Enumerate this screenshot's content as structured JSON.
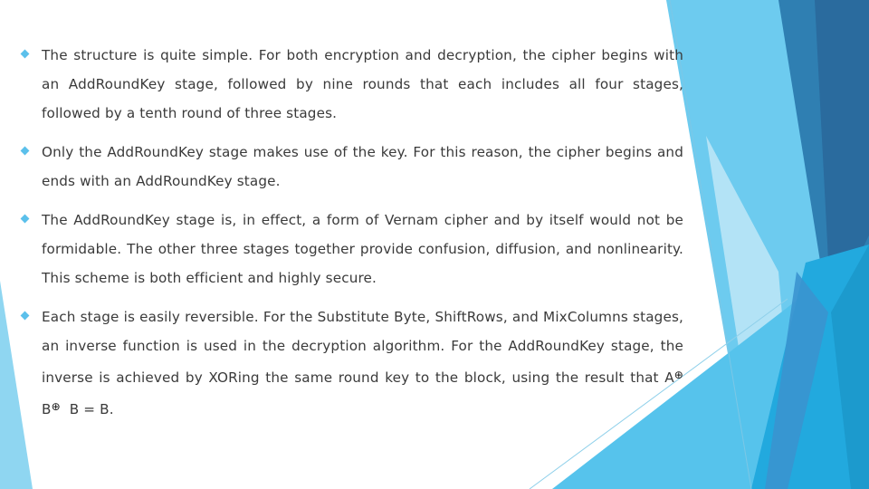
{
  "slide": {
    "colors": {
      "bullet": "#5bc0eb",
      "text": "#3a3a3a",
      "decor_dark": "#2a6b9e",
      "decor_mid": "#2f7fb2",
      "decor_light": "#6dcbef",
      "decor_pale": "#bfe7f7",
      "decor_cyan": "#22a9de"
    },
    "bullets": [
      {
        "icon": "diamond-bullet-icon",
        "text": "The structure is quite simple. For both encryption and decryption, the cipher begins with an AddRoundKey stage, followed by nine rounds that each includes all four stages, followed by a tenth round of three stages."
      },
      {
        "icon": "diamond-bullet-icon",
        "text": "Only the AddRoundKey stage makes use of the key. For this reason, the cipher begins and ends with an AddRoundKey stage."
      },
      {
        "icon": "diamond-bullet-icon",
        "text": "The AddRoundKey stage is, in effect, a form of Vernam cipher and by itself would not be formidable. The other three stages together provide confusion, diffusion, and nonlinearity. This scheme is both efficient and highly secure."
      },
      {
        "icon": "diamond-bullet-icon",
        "text": "Each stage is easily reversible. For the Substitute Byte, ShiftRows, and MixColumns stages, an inverse function is used in the decryption algorithm. For the AddRoundKey stage, the inverse is achieved by XORing the same round key to the block, using the",
        "formula": {
          "prefix": " result that A",
          "op1": "⊕",
          "mid": " B",
          "op2": "⊕",
          "suffix": "  B = B."
        }
      }
    ]
  }
}
